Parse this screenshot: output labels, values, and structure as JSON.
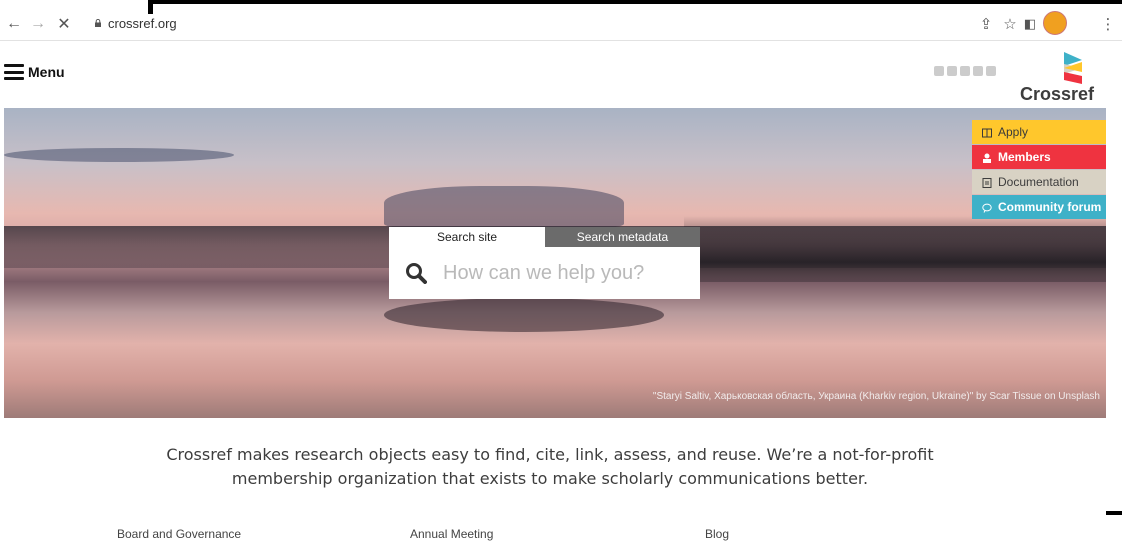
{
  "browser": {
    "url": "crossref.org",
    "back_icon": "back-arrow-icon",
    "forward_icon": "forward-arrow-icon",
    "stop_icon": "close-icon"
  },
  "header": {
    "menu_label": "Menu",
    "logo_text": "Crossref"
  },
  "quicklinks": [
    {
      "label": "Apply",
      "icon": "book-icon",
      "color": "#ffc72c"
    },
    {
      "label": "Members",
      "icon": "person-icon",
      "color": "#ef3340"
    },
    {
      "label": "Documentation",
      "icon": "doc-icon",
      "color": "#d8d2c4"
    },
    {
      "label": "Community forum",
      "icon": "chat-icon",
      "color": "#3eb1c8"
    }
  ],
  "search": {
    "tab_site": "Search site",
    "tab_metadata": "Search metadata",
    "placeholder": "How can we help you?"
  },
  "hero": {
    "credit": "\"Staryi Saltiv, Харьковская область, Украина (Kharkiv region, Ukraine)\" by Scar Tissue on Unsplash"
  },
  "tagline": {
    "line1": "Crossref makes research objects easy to find, cite, link, assess, and reuse. We’re a not-for-profit",
    "line2": "membership organization that exists to make scholarly communications better."
  },
  "footer_links": [
    "Board and Governance",
    "Annual Meeting",
    "Blog"
  ]
}
